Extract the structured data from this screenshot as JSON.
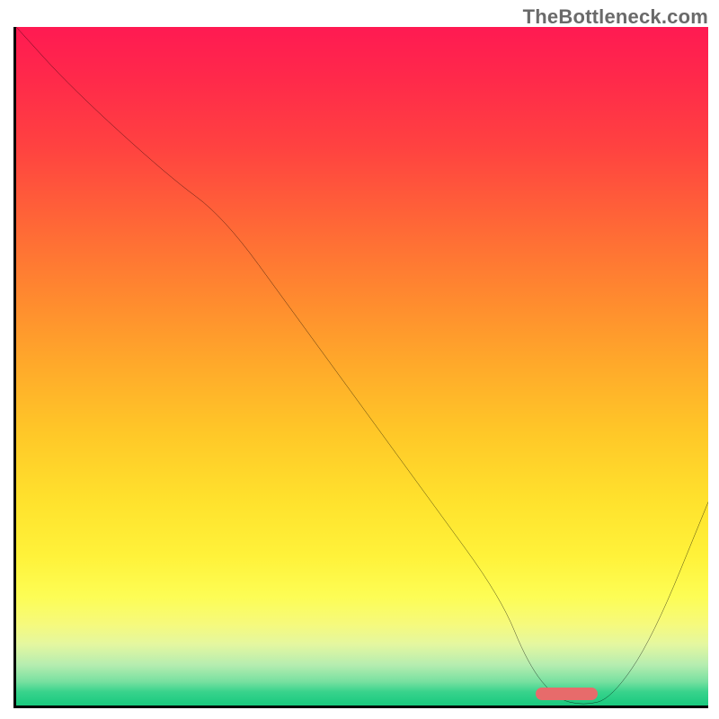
{
  "watermark": "TheBottleneck.com",
  "chart_data": {
    "type": "line",
    "title": "",
    "xlabel": "",
    "ylabel": "",
    "xlim": [
      0,
      100
    ],
    "ylim": [
      0,
      100
    ],
    "x": [
      0,
      8,
      22,
      30,
      40,
      50,
      60,
      70,
      74,
      78,
      82,
      86,
      92,
      100
    ],
    "y": [
      100,
      91,
      78,
      72,
      58,
      44,
      30,
      16,
      6,
      1,
      0,
      1,
      10,
      30
    ],
    "marker": {
      "x_start": 75,
      "x_end": 84,
      "y": 0.8
    },
    "gradient_stops": [
      {
        "pos": 0,
        "color": "#ff1a52"
      },
      {
        "pos": 50,
        "color": "#ffaa2a"
      },
      {
        "pos": 84,
        "color": "#fdfd55"
      },
      {
        "pos": 100,
        "color": "#19c97e"
      }
    ]
  }
}
